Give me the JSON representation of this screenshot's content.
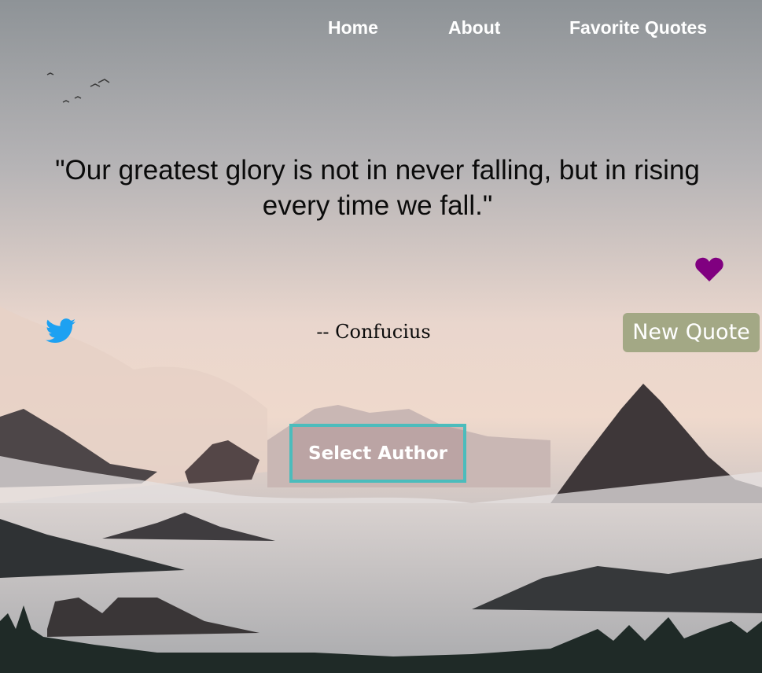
{
  "nav": {
    "home": "Home",
    "about": "About",
    "favorites": "Favorite Quotes"
  },
  "quote": {
    "text": "\"Our greatest glory is not in never falling, but in rising every time we fall.\"",
    "author": "-- Confucius"
  },
  "buttons": {
    "new_quote": "New Quote",
    "select_author": "Select Author"
  },
  "icons": {
    "favorite": "heart-icon",
    "share": "twitter-icon"
  },
  "colors": {
    "heart": "#800080",
    "twitter": "#1da1f2",
    "select_border": "#4bbcbc",
    "new_quote_bg": "#96a078"
  }
}
